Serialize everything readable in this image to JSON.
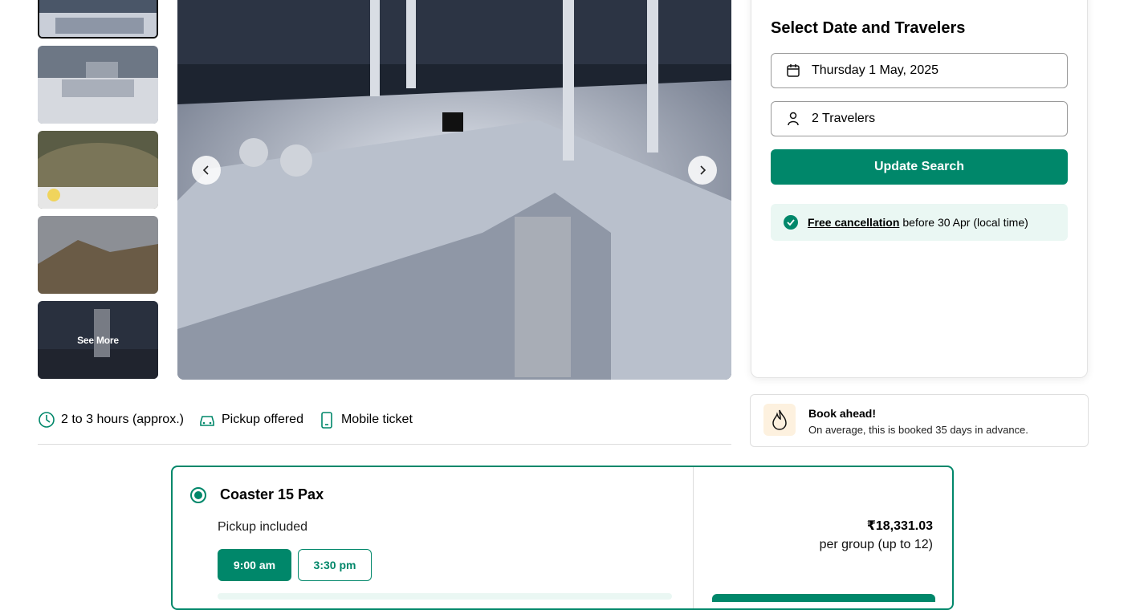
{
  "gallery": {
    "see_more_label": "See More"
  },
  "booking": {
    "title": "Select Date and Travelers",
    "date_value": "Thursday 1 May, 2025",
    "travelers_value": "2 Travelers",
    "update_button": "Update Search",
    "cancellation_link": "Free cancellation",
    "cancellation_text": "before 30 Apr (local time)"
  },
  "book_ahead": {
    "title": "Book ahead!",
    "subtitle": "On average, this is booked 35 days in advance."
  },
  "features": [
    {
      "label": "2 to 3 hours (approx.)",
      "icon": "clock-icon"
    },
    {
      "label": "Pickup offered",
      "icon": "car-icon"
    },
    {
      "label": "Mobile ticket",
      "icon": "mobile-icon"
    }
  ],
  "option": {
    "title": "Coaster 15 Pax",
    "pickup": "Pickup included",
    "times": [
      "9:00 am",
      "3:30 pm"
    ],
    "price": "₹18,331.03",
    "price_unit": "per group (up to 12)"
  },
  "colors": {
    "brand": "#00876a",
    "brand_light": "#eaf7f3",
    "flame_bg": "#fdf1df"
  }
}
